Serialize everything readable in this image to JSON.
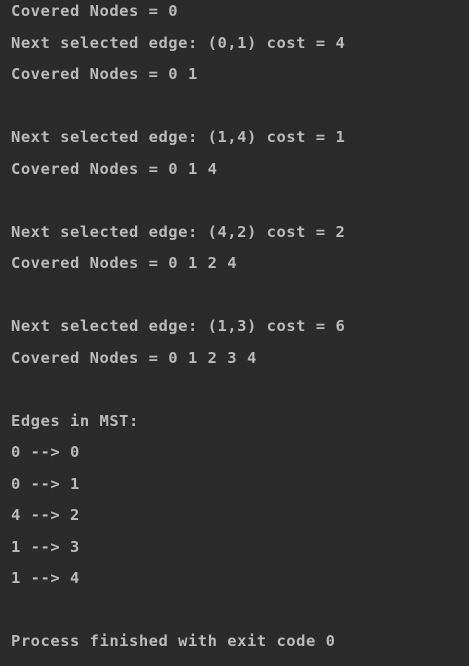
{
  "console": {
    "lines": [
      "Covered Nodes = 0",
      "Next selected edge: (0,1) cost = 4",
      "Covered Nodes = 0 1",
      "",
      "Next selected edge: (1,4) cost = 1",
      "Covered Nodes = 0 1 4",
      "",
      "Next selected edge: (4,2) cost = 2",
      "Covered Nodes = 0 1 2 4",
      "",
      "Next selected edge: (1,3) cost = 6",
      "Covered Nodes = 0 1 2 3 4",
      "",
      "Edges in MST:",
      "0 --> 0",
      "0 --> 1",
      "4 --> 2",
      "1 --> 3",
      "1 --> 4",
      "",
      "Process finished with exit code 0"
    ]
  },
  "colors": {
    "background": "#2b2b2b",
    "text": "#bbbbbb"
  }
}
